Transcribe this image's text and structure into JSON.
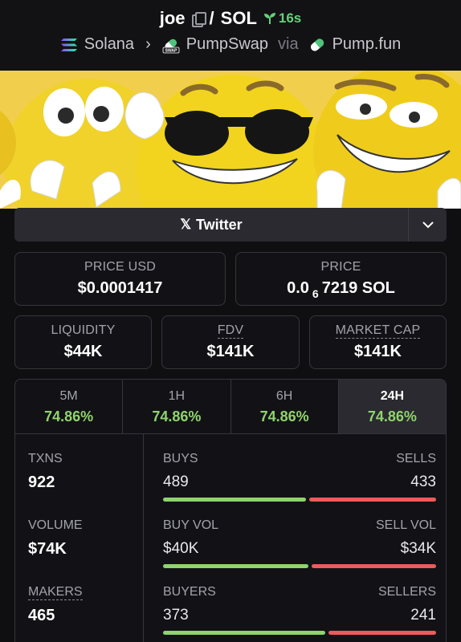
{
  "header": {
    "token": "joe",
    "separator": "/",
    "quote": "SOL",
    "age": "16s",
    "chain": "Solana",
    "dex": "PumpSwap",
    "via": "via",
    "launchpad": "Pump.fun"
  },
  "social": {
    "twitter_label": "Twitter"
  },
  "price_usd": {
    "label": "PRICE USD",
    "value": "$0.0001417"
  },
  "price": {
    "label": "PRICE",
    "prefix": "0.0",
    "zeros": "6",
    "suffix": "7219 SOL"
  },
  "liquidity": {
    "label": "LIQUIDITY",
    "value": "$44K"
  },
  "fdv": {
    "label": "FDV",
    "value": "$141K"
  },
  "market_cap": {
    "label": "MARKET CAP",
    "value": "$141K"
  },
  "tabs": [
    {
      "label": "5M",
      "value": "74.86%"
    },
    {
      "label": "1H",
      "value": "74.86%"
    },
    {
      "label": "6H",
      "value": "74.86%"
    },
    {
      "label": "24H",
      "value": "74.86%"
    }
  ],
  "active_tab": "24H",
  "metrics": {
    "txns": {
      "label": "TXNS",
      "value": "922"
    },
    "volume": {
      "label": "VOLUME",
      "value": "$74K"
    },
    "makers": {
      "label": "MAKERS",
      "value": "465"
    }
  },
  "splits": {
    "txns": {
      "left_label": "BUYS",
      "right_label": "SELLS",
      "left_value": "489",
      "right_value": "433",
      "buy_share": 0.53
    },
    "volume": {
      "left_label": "BUY VOL",
      "right_label": "SELL VOL",
      "left_value": "$40K",
      "right_value": "$34K",
      "buy_share": 0.54
    },
    "makers": {
      "left_label": "BUYERS",
      "right_label": "SELLERS",
      "left_value": "373",
      "right_value": "241",
      "buy_share": 0.6
    }
  },
  "colors": {
    "positive": "#8fd46c",
    "negative": "#ec5b5b",
    "age": "#63d27a",
    "background": "#0f0f12"
  }
}
